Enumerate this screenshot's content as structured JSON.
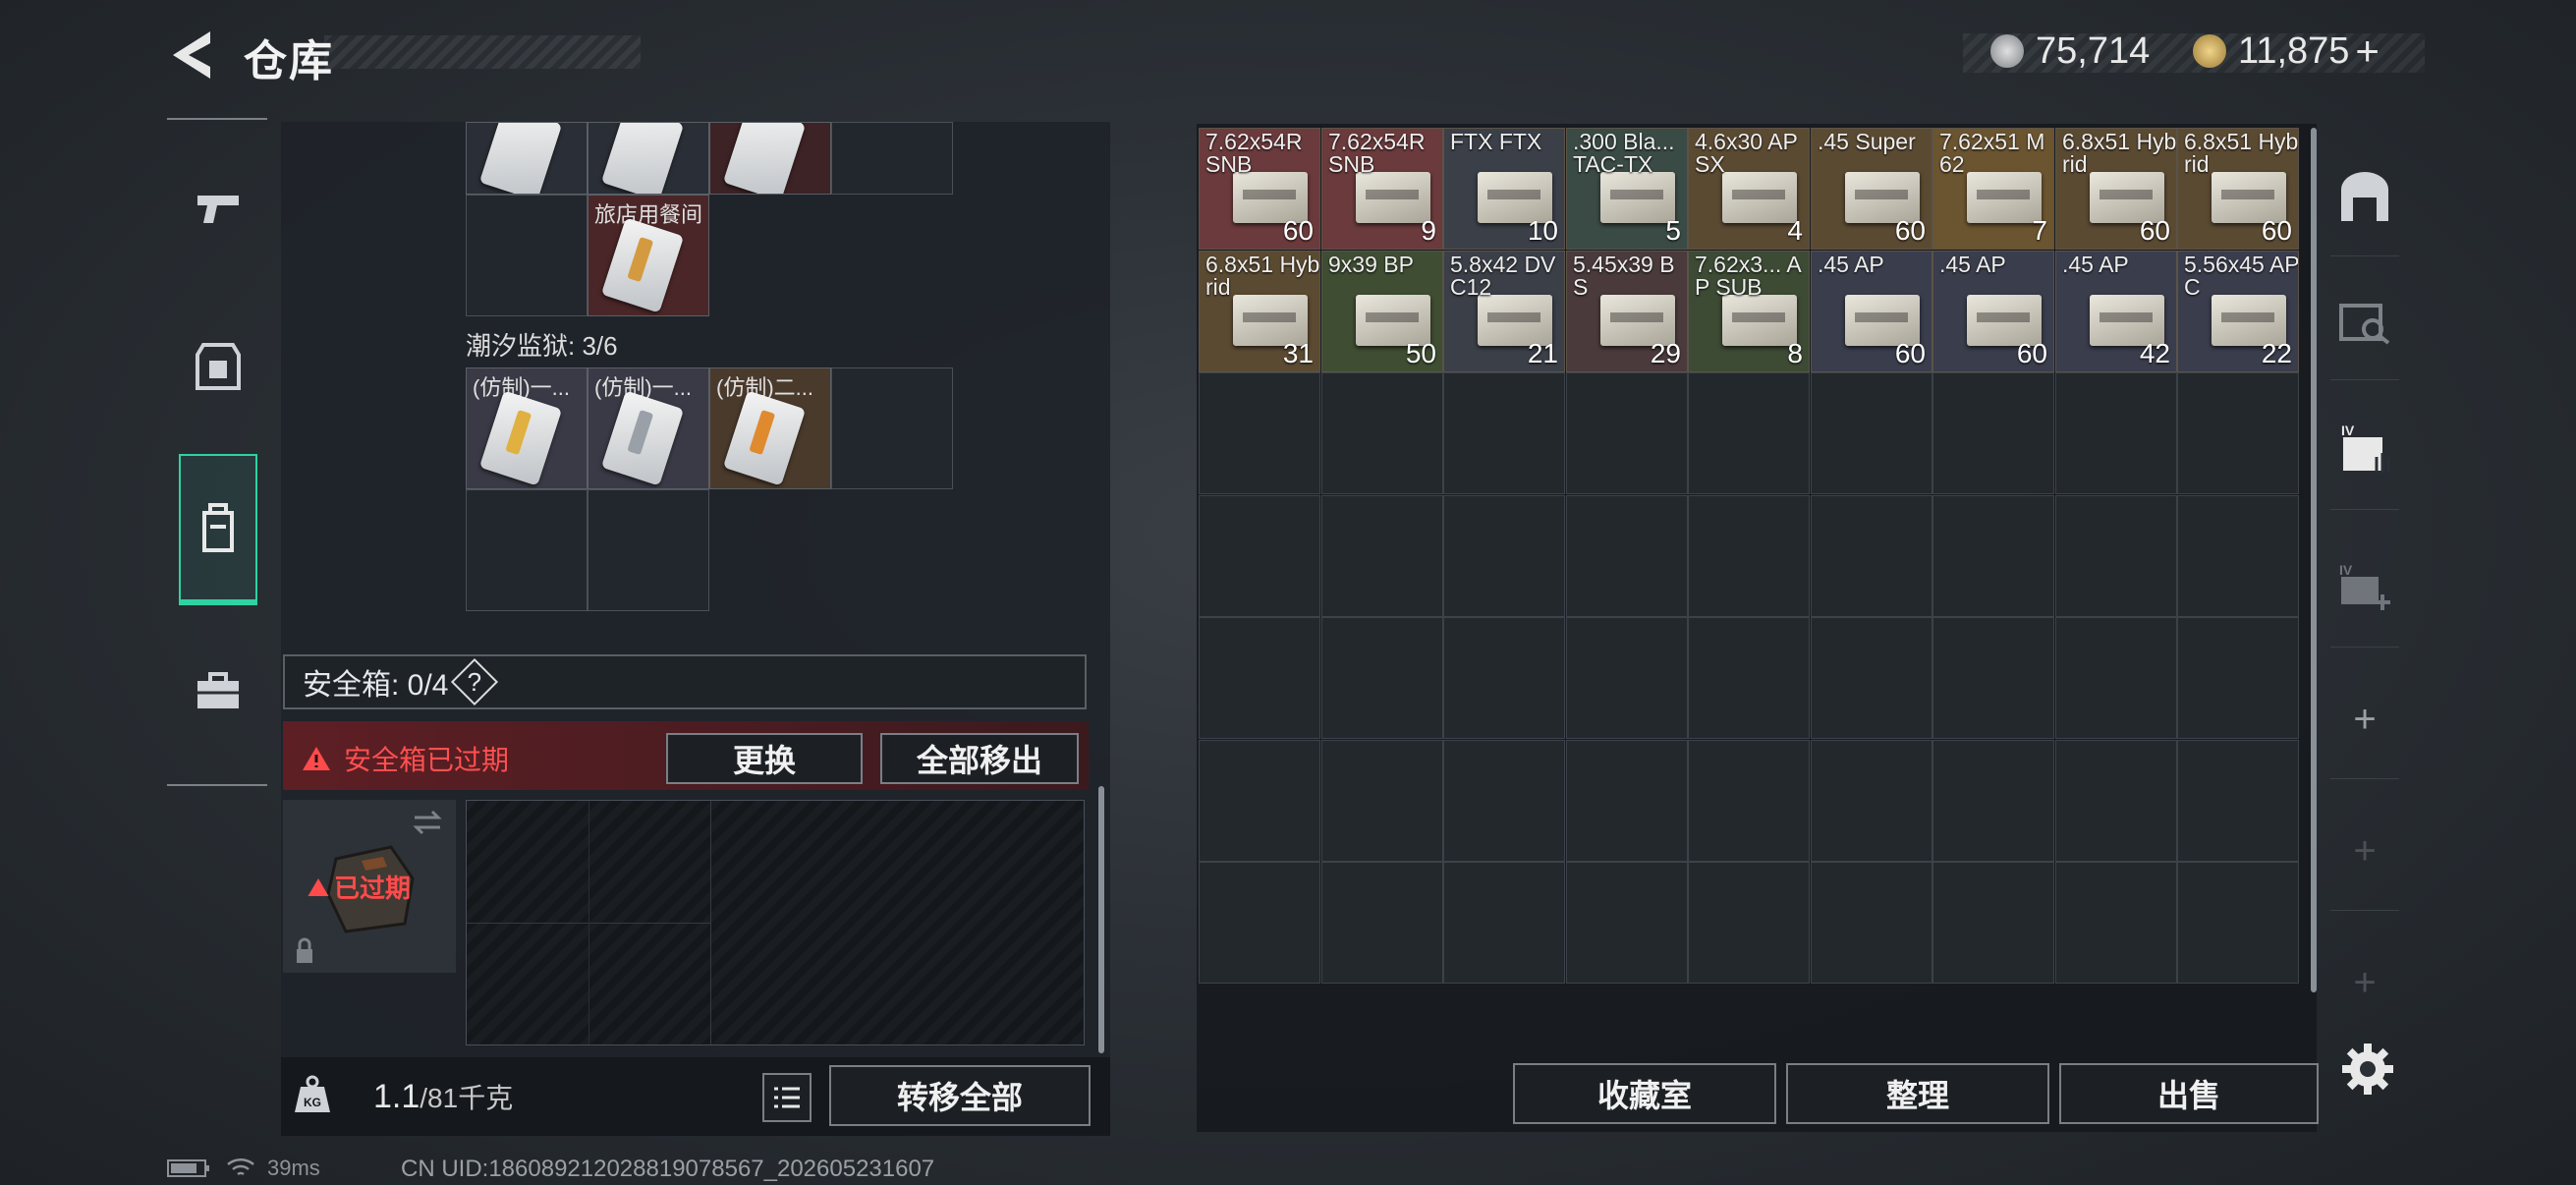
{
  "header": {
    "title": "仓库",
    "currency_silver": "75,714",
    "currency_gold": "11,875",
    "gold_add": "+"
  },
  "nav": [
    "weapon-tab",
    "armor-tab",
    "backpack-tab",
    "toolbox-tab"
  ],
  "left": {
    "top_keycard_label": "旅店用餐间",
    "prison_section": "潮汐监狱: 3/6",
    "prison_items": [
      "(仿制)一...",
      "(仿制)一...",
      "(仿制)二..."
    ],
    "safebox_label": "安全箱: 0/4",
    "help": "?",
    "warning": "安全箱已过期",
    "replace_btn": "更换",
    "remove_all_btn": "全部移出",
    "expired_badge": "已过期",
    "weight_value": "1.1",
    "weight_max": "/81千克",
    "transfer_all_btn": "转移全部"
  },
  "ammo": [
    {
      "name": "7.62x54R SNB",
      "count": "60",
      "color": "#6b3a3c"
    },
    {
      "name": "7.62x54R SNB",
      "count": "9",
      "color": "#6b3a3c"
    },
    {
      "name": "FTX FTX",
      "count": "10",
      "color": "#3b3f48"
    },
    {
      "name": ".300 Bla... TAC-TX",
      "count": "5",
      "color": "#3a4a44"
    },
    {
      "name": "4.6x30 AP SX",
      "count": "4",
      "color": "#5b4a32"
    },
    {
      "name": ".45 Super",
      "count": "60",
      "color": "#5b4a32"
    },
    {
      "name": "7.62x51 M62",
      "count": "7",
      "color": "#6b5430"
    },
    {
      "name": "6.8x51 Hybrid",
      "count": "60",
      "color": "#5b4a32"
    },
    {
      "name": "6.8x51 Hybrid",
      "count": "60",
      "color": "#5b4a32"
    },
    {
      "name": "6.8x51 Hybrid",
      "count": "31",
      "color": "#5b4a32"
    },
    {
      "name": "9x39 BP",
      "count": "50",
      "color": "#3f4d32"
    },
    {
      "name": "5.8x42 DVC12",
      "count": "21",
      "color": "#3b3f48"
    },
    {
      "name": "5.45x39 BS",
      "count": "29",
      "color": "#4a3a3c"
    },
    {
      "name": "7.62x3... AP SUB",
      "count": "8",
      "color": "#3d4a34"
    },
    {
      "name": ".45 AP",
      "count": "60",
      "color": "#3a3d4c"
    },
    {
      "name": ".45 AP",
      "count": "60",
      "color": "#3a3d4c"
    },
    {
      "name": ".45 AP",
      "count": "42",
      "color": "#3a3d4c"
    },
    {
      "name": "5.56x45 APC",
      "count": "22",
      "color": "#3a3d4c"
    }
  ],
  "right_buttons": {
    "collection": "收藏室",
    "sort": "整理",
    "sell": "出售"
  },
  "status": {
    "ping": "39ms",
    "uid": "CN UID:1860892120288190785​67_202605231607"
  }
}
